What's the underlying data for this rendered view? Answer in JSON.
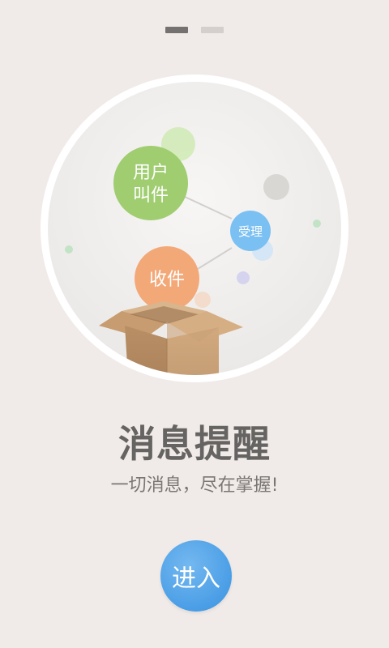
{
  "pager": {
    "pages": 2,
    "current": 1
  },
  "illustration": {
    "bubble_user_line1": "用户",
    "bubble_user_line2": "叫件",
    "bubble_accept": "受理",
    "bubble_receive": "收件",
    "colors": {
      "user_bubble": "#9fcd70",
      "accept_bubble": "#7bc0f2",
      "receive_bubble": "#f3a878",
      "box": "#c9a27a"
    }
  },
  "content": {
    "title": "消息提醒",
    "subtitle": "一切消息，尽在掌握!"
  },
  "actions": {
    "enter_label": "进入",
    "accent": "#4a9ee6"
  }
}
